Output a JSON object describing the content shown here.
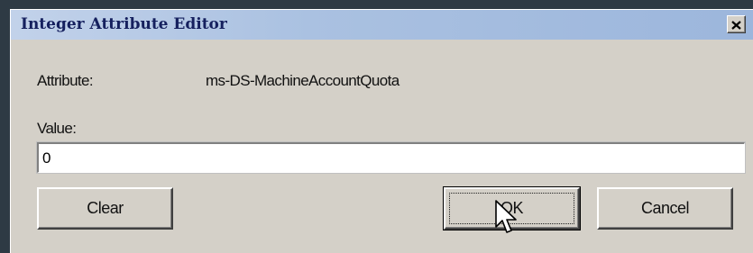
{
  "dialog": {
    "title": "Integer Attribute Editor",
    "close_symbol": "✕"
  },
  "fields": {
    "attribute_label": "Attribute:",
    "attribute_value": "ms-DS-MachineAccountQuota",
    "value_label": "Value:",
    "value": "0"
  },
  "buttons": {
    "clear": "Clear",
    "ok": "OK",
    "cancel": "Cancel"
  },
  "icons": {
    "close": "close-icon",
    "cursor": "mouse-pointer-icon"
  },
  "colors": {
    "dialog_bg": "#d4d0c8",
    "title_text": "#15205e",
    "desktop_bg": "#2e3a44"
  }
}
